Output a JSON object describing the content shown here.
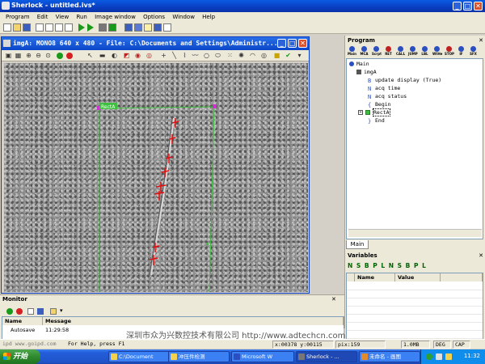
{
  "window": {
    "title": "Sherlock - untitled.ivs*",
    "minimize": "_",
    "maximize": "□",
    "close": "✕"
  },
  "menu": [
    "Program",
    "Edit",
    "View",
    "Run",
    "Image window",
    "Options",
    "Window",
    "Help"
  ],
  "image_window": {
    "title": "imgA: MONO8 640 x 480 - File: C:\\Documents and Settings\\Administr...",
    "roi_label": "RectA"
  },
  "program_panel": {
    "header": "Program",
    "toolbar": [
      "Main",
      "MCA",
      "Scrpt",
      "RET",
      "CALL",
      "JUMP",
      "LBL",
      "WtHe",
      "STOP",
      "IF",
      "SFX"
    ],
    "tree": [
      {
        "label": "Main",
        "indent": 0
      },
      {
        "label": "imgA",
        "indent": 1
      },
      {
        "label": "update display (True)",
        "indent": 2
      },
      {
        "label": "acq time",
        "indent": 2
      },
      {
        "label": "acq status",
        "indent": 2
      },
      {
        "label": "Begin",
        "indent": 2
      },
      {
        "label": "RectA",
        "indent": 2
      },
      {
        "label": "End",
        "indent": 2
      }
    ],
    "tab": "Main"
  },
  "variables_panel": {
    "header": "Variables",
    "toolbar_text": "N S B P L N S B P L",
    "columns": [
      "Name",
      "Value"
    ]
  },
  "monitor": {
    "header": "Monitor",
    "columns": [
      "Name",
      "Message"
    ],
    "rows": [
      {
        "name": "Autosave",
        "message": "11:29:58"
      }
    ]
  },
  "watermark": "深圳市众为兴数控技术有限公司 http://www.adtechcn.com",
  "watermark_site": "ipd  www.goipd.com",
  "statusbar": {
    "help": "For Help, press F1",
    "coords": "x:00378 y:00115",
    "pix": "pix:159",
    "mem": "1.0MB",
    "deg": "DEG",
    "cap": "CAP"
  },
  "taskbar": {
    "start": "开始",
    "tasks": [
      "C:\\Document",
      "冲压件检测",
      "Microsoft W",
      "Sherlock - ...",
      "未命名 - 画图"
    ],
    "clock": "11:32"
  },
  "colors": {
    "titlebar": "#0a46c8",
    "roi": "#3fbf3f",
    "handle": "#cc33cc",
    "defect": "#e01010"
  }
}
